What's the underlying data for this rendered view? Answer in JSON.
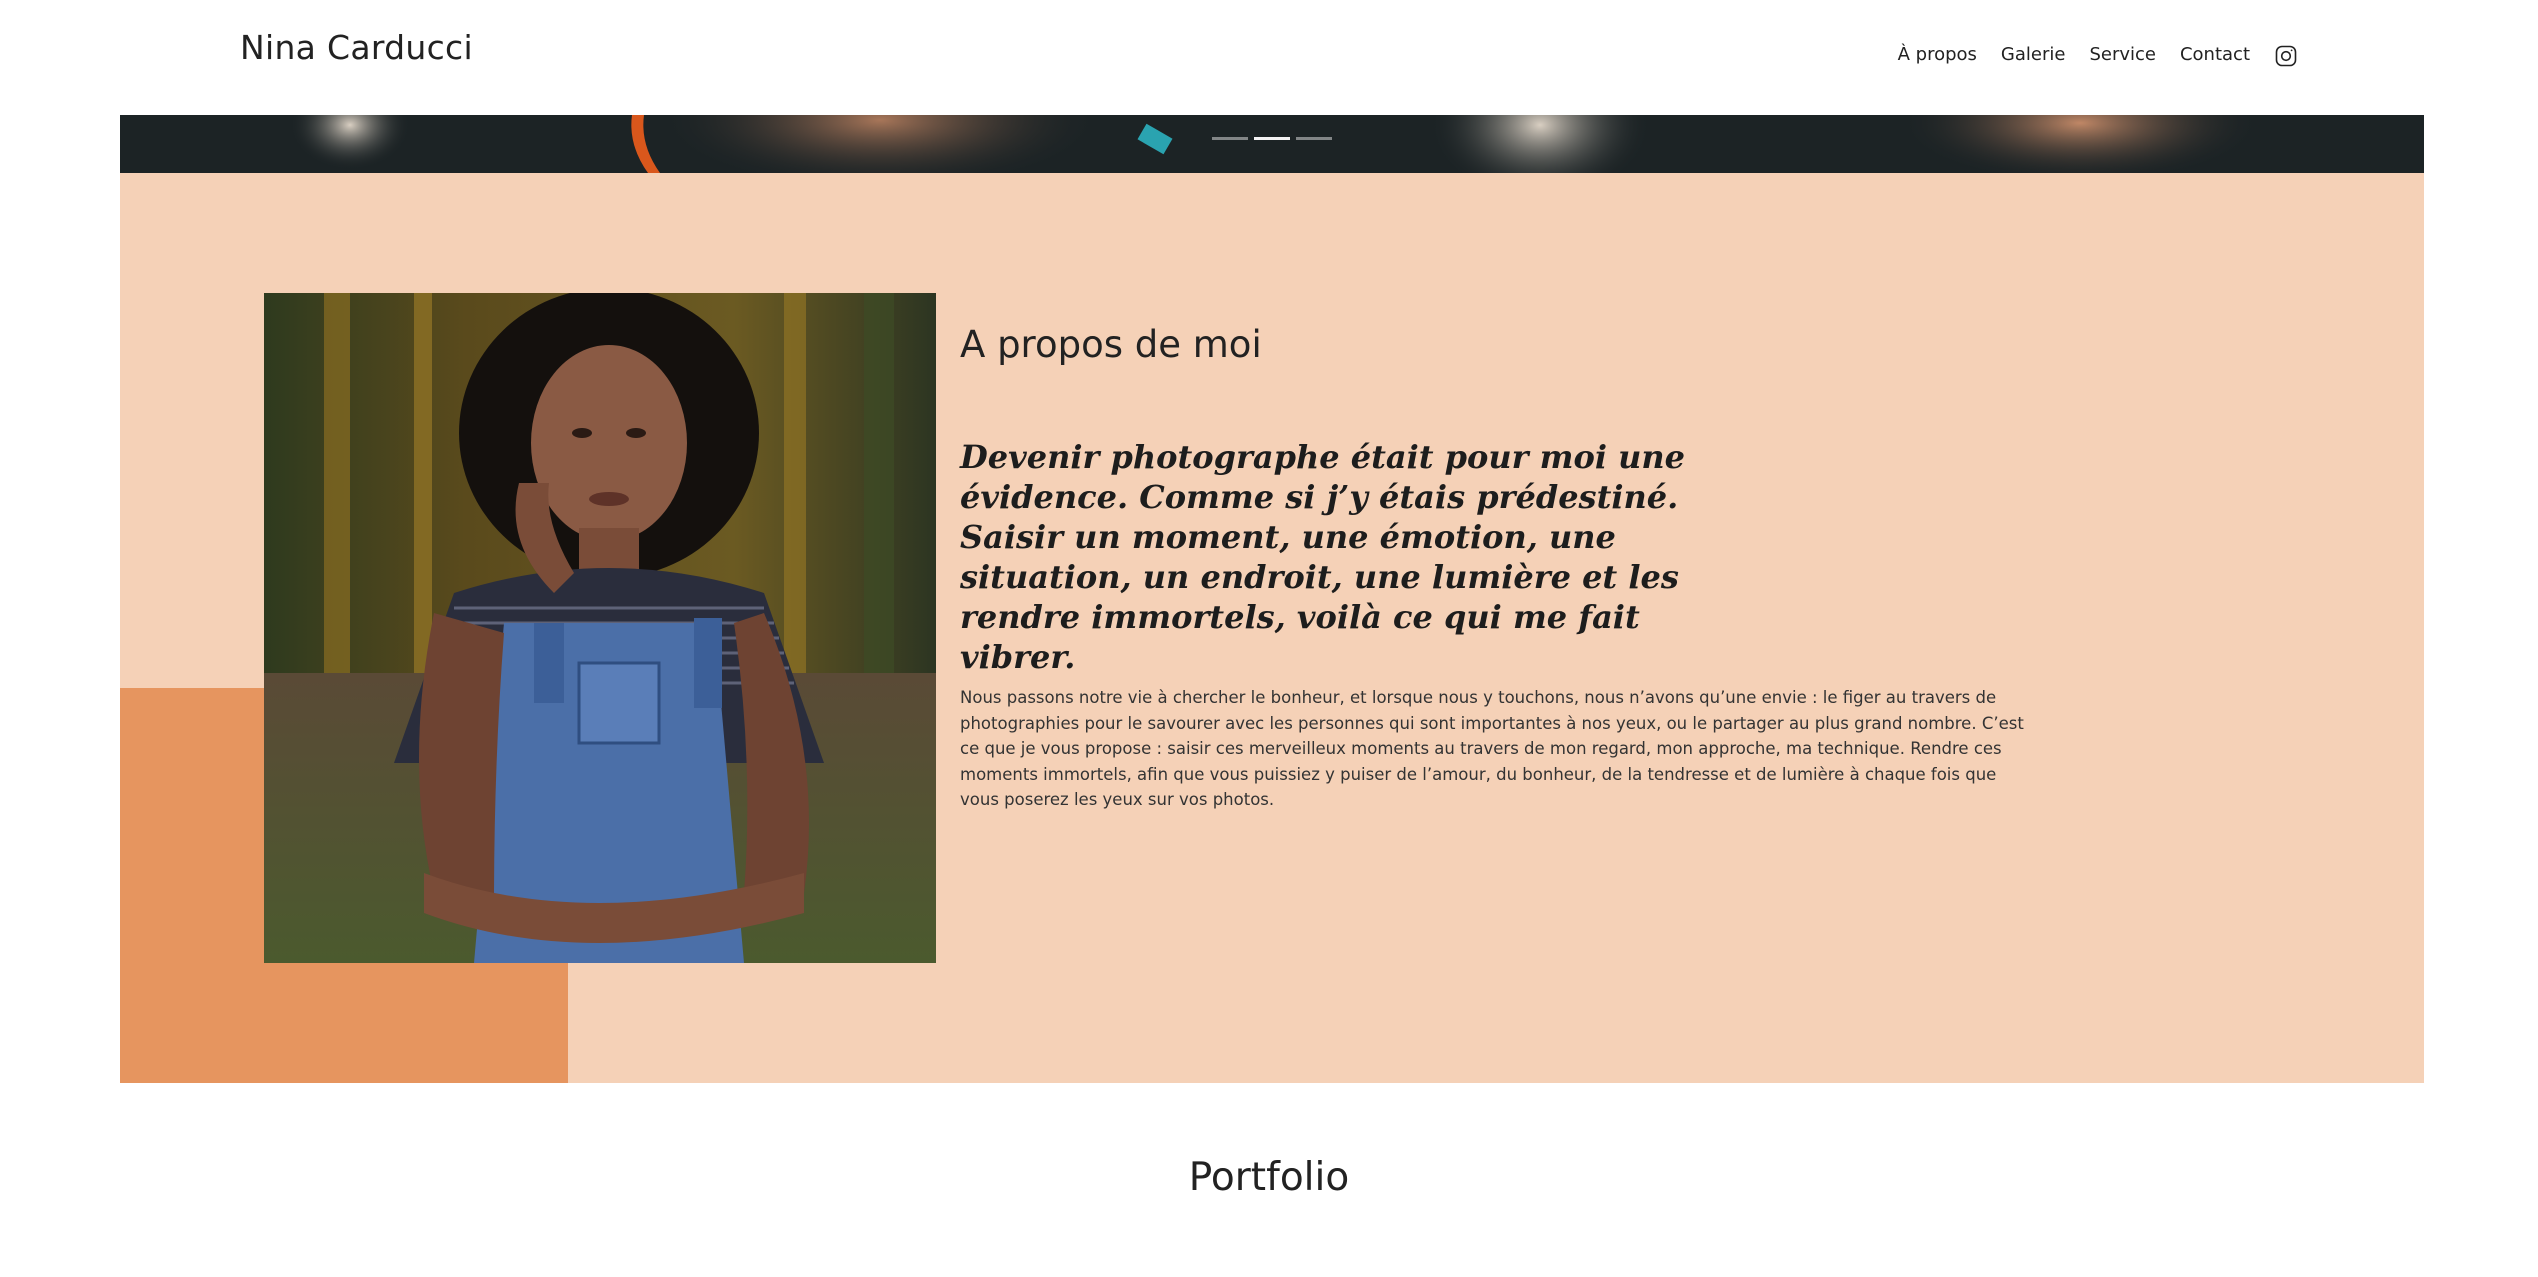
{
  "header": {
    "brand": "Nina Carducci",
    "nav": [
      {
        "label": "À propos"
      },
      {
        "label": "Galerie"
      },
      {
        "label": "Service"
      },
      {
        "label": "Contact"
      }
    ],
    "instagram_icon": "instagram-icon"
  },
  "hero": {
    "slides_count": 3,
    "active_slide": 2
  },
  "about": {
    "title": "A propos de moi",
    "quote": "Devenir photographe était pour moi une évidence. Comme si j’y étais prédestiné. Saisir un moment, une émotion, une situation, un endroit, une lumière et les rendre immortels, voilà ce qui me fait vibrer.",
    "body": "Nous passons notre vie à chercher le bonheur, et lorsque nous y touchons, nous n’avons qu’une envie : le figer au travers de photographies pour le savourer avec les personnes qui sont importantes à nos yeux, ou le partager au plus grand nombre. C’est ce que je vous propose : saisir ces merveilleux moments au travers de mon regard, mon approche, ma technique. Rendre ces moments immortels, afin que vous puissiez y puiser de l’amour, du bonheur, de la tendresse et de lumière à chaque fois que vous poserez les yeux sur vos photos."
  },
  "portfolio": {
    "title": "Portfolio"
  },
  "colors": {
    "about_bg": "#f5d1b7",
    "accent": "#e6955f",
    "text": "#222222"
  }
}
